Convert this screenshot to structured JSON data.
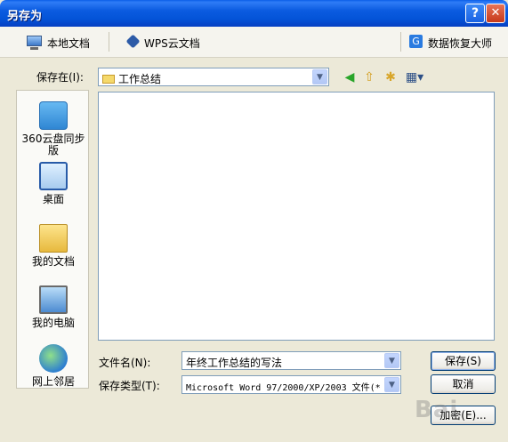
{
  "window": {
    "title": "另存为",
    "help_glyph": "?",
    "close_glyph": "✕"
  },
  "topbar": {
    "local_docs": "本地文档",
    "wps_cloud": "WPS云文档",
    "data_recovery": "数据恢复大师"
  },
  "save_in": {
    "label": "保存在(I):",
    "value": "工作总结"
  },
  "places": [
    {
      "label": "360云盘同步版",
      "icon": "cloud-sync-icon"
    },
    {
      "label": "桌面",
      "icon": "desktop-icon"
    },
    {
      "label": "我的文档",
      "icon": "my-documents-icon"
    },
    {
      "label": "我的电脑",
      "icon": "my-computer-icon"
    },
    {
      "label": "网上邻居",
      "icon": "network-icon"
    }
  ],
  "filename": {
    "label": "文件名(N):",
    "value": "年终工作总结的写法"
  },
  "filetype": {
    "label": "保存类型(T):",
    "value": "Microsoft Word 97/2000/XP/2003 文件(*"
  },
  "buttons": {
    "save": "保存(S)",
    "cancel": "取消",
    "encrypt": "加密(E)..."
  },
  "watermark": "Bai"
}
